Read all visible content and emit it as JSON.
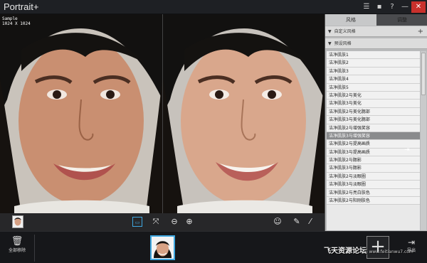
{
  "app": {
    "title": "Portrait+"
  },
  "titlebar": {
    "icons": [
      "list-icon",
      "chat-icon",
      "help-icon",
      "minimize-icon",
      "close-icon"
    ],
    "help_label": "?",
    "close_label": "✕",
    "minimize_label": "—"
  },
  "image": {
    "name": "Sample",
    "size": "1024 X 1024"
  },
  "panel": {
    "tabs": [
      {
        "label": "风格"
      },
      {
        "label": "调整"
      }
    ],
    "custom_section": {
      "label": "自定义风格"
    },
    "preset_section": {
      "label": "预设风格"
    },
    "styles": [
      {
        "label": "洁净肌肤1"
      },
      {
        "label": "洁净肌肤2"
      },
      {
        "label": "洁净肌肤3"
      },
      {
        "label": "洁净肌肤4"
      },
      {
        "label": "洁净肌肤5"
      },
      {
        "label": "洁净肌肤2与美化"
      },
      {
        "label": "洁净肌肤3与美化"
      },
      {
        "label": "洁净肌肤2与美化腮部"
      },
      {
        "label": "洁净肌肤3与美化腮部"
      },
      {
        "label": "洁净肌肤2与增强笑容"
      },
      {
        "label": "洁净肌肤3与增强笑容",
        "selected": true
      },
      {
        "label": "洁净肌肤2与提高画质"
      },
      {
        "label": "洁净肌肤3与提高画质"
      },
      {
        "label": "洁净肌肤2与腮影"
      },
      {
        "label": "洁净肌肤3与腮影"
      },
      {
        "label": "洁净肌肤2与淡眼圈"
      },
      {
        "label": "洁净肌肤3与淡眼圈"
      },
      {
        "label": "洁净肌肤2与亮白肤色"
      },
      {
        "label": "洁净肌肤2与阳刚肤色"
      }
    ]
  },
  "bottom": {
    "clear_all": "全部移除",
    "add": "+",
    "export": "导出"
  },
  "watermark": {
    "text": "飞天资源论坛",
    "url": "www.feitianwu7.com"
  },
  "colors": {
    "selected": "#8a8b8d",
    "accent": "#3fa7e0"
  }
}
